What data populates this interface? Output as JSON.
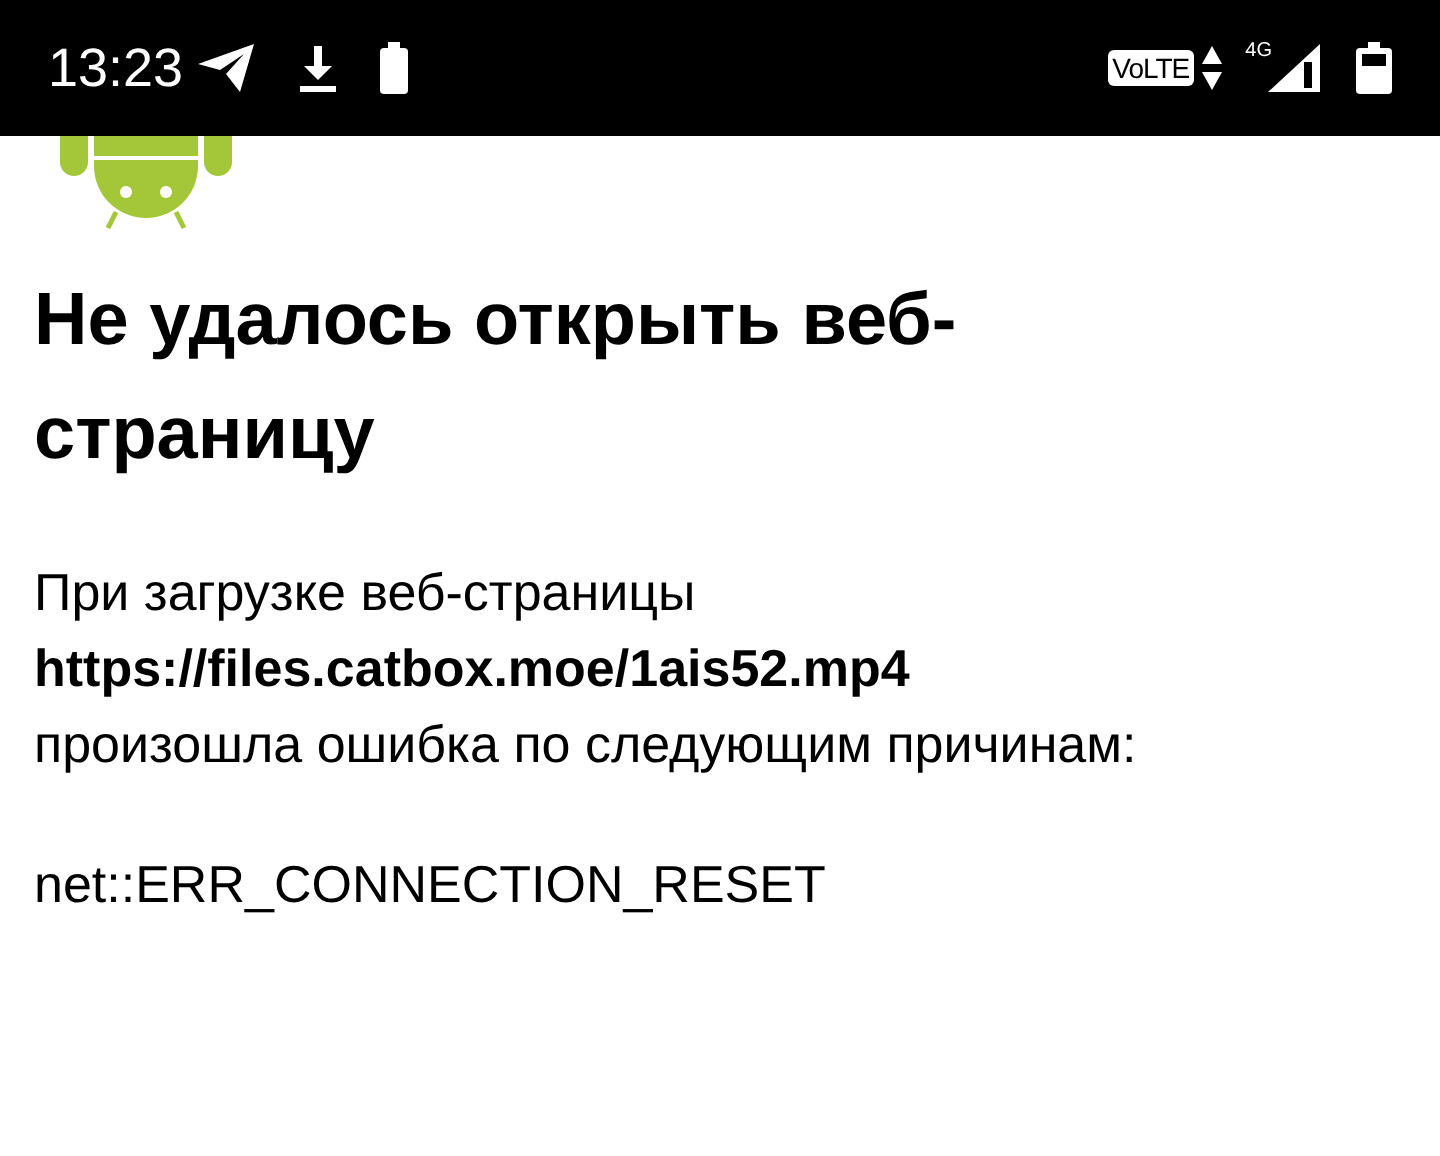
{
  "status_bar": {
    "time": "13:23",
    "volte": "VoLTE",
    "network": "4G"
  },
  "error_page": {
    "title": "Не удалось открыть веб-страницу",
    "message": "При загрузке веб-страницы **https://files.catbox.moe/1ais52.mp4** произошла ошибка по следующим причинам:",
    "error_code": "net::ERR_CONNECTION_RESET"
  }
}
